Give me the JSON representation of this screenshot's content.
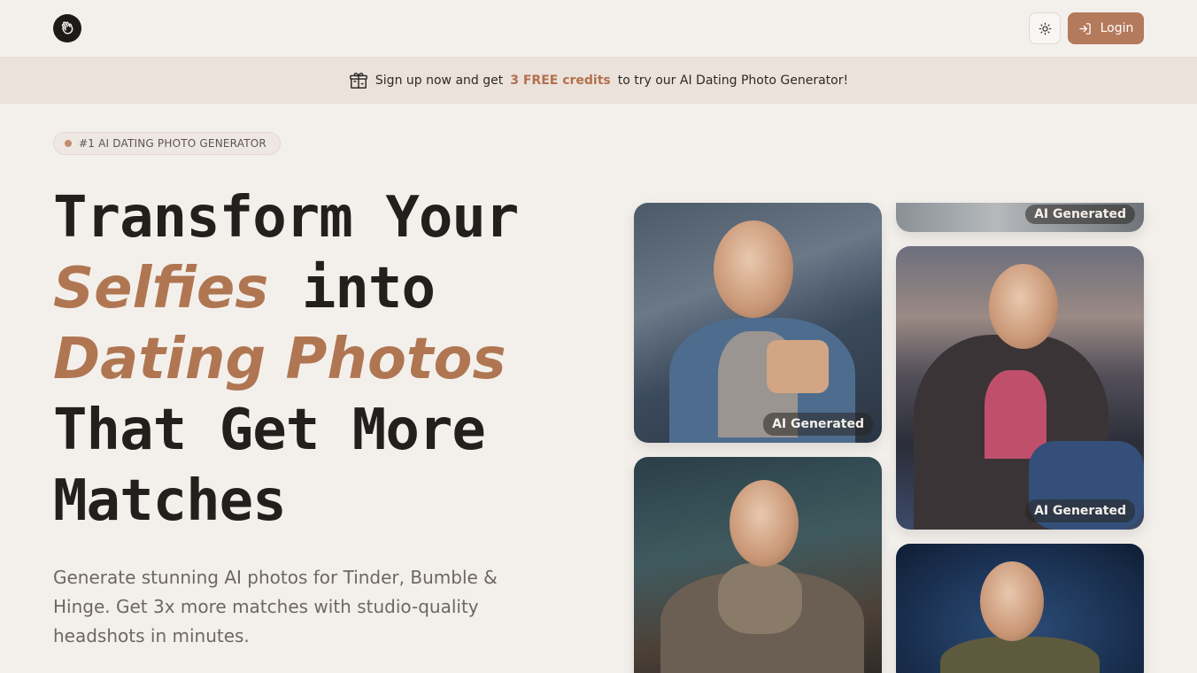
{
  "header": {
    "logo_icon": "waving-hand-icon",
    "theme_toggle_icon": "sun-icon",
    "login_label": "Login",
    "login_icon": "log-in-icon",
    "accent_color": "#b47a5c"
  },
  "banner": {
    "icon": "gift-icon",
    "text_before": "Sign up now and get",
    "highlight": "3 FREE credits",
    "text_after": "to try our AI Dating Photo Generator!"
  },
  "hero": {
    "badge": "#1 AI DATING PHOTO GENERATOR",
    "title_line1": "Transform Your",
    "title_accent1": "Selfies",
    "title_line2_rest": "into",
    "title_accent2": "Dating Photos",
    "title_line4": "That Get More",
    "title_line5": "Matches",
    "subtitle": "Generate stunning AI photos for Tinder, Bumble & Hinge. Get 3x more matches with studio-quality headshots in minutes."
  },
  "gallery": {
    "tag": "AI Generated"
  }
}
